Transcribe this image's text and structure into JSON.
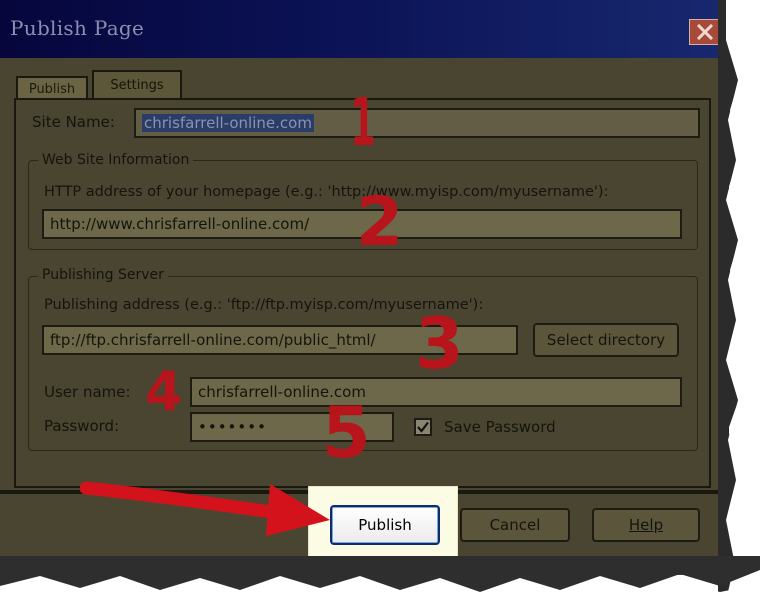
{
  "window": {
    "title": "Publish Page",
    "close_icon": "close-icon"
  },
  "tabs": [
    {
      "label": "Publish"
    },
    {
      "label": "Settings"
    }
  ],
  "site_name": {
    "label": "Site Name:",
    "value": "chrisfarrell-online.com"
  },
  "web_site_info": {
    "group_title": "Web Site Information",
    "http_label": "HTTP address of your homepage (e.g.: 'http://www.myisp.com/myusername'):",
    "http_value": "http://www.chrisfarrell-online.com/"
  },
  "publishing_server": {
    "group_title": "Publishing Server",
    "address_label": "Publishing address (e.g.: 'ftp://ftp.myisp.com/myusername'):",
    "address_value": "ftp://ftp.chrisfarrell-online.com/public_html/",
    "select_directory": "Select directory",
    "username_label": "User name:",
    "username_value": "chrisfarrell-online.com",
    "password_label": "Password:",
    "password_value": "•••••••",
    "save_password_label": "Save Password",
    "save_password_checked": true
  },
  "buttons": {
    "publish": "Publish",
    "cancel": "Cancel",
    "help": "Help"
  },
  "annotations": [
    "1",
    "2",
    "3",
    "4",
    "5"
  ],
  "colors": {
    "annotation": "#b8141c",
    "arrow": "#d4121c",
    "highlight": "#fcfbe3"
  }
}
